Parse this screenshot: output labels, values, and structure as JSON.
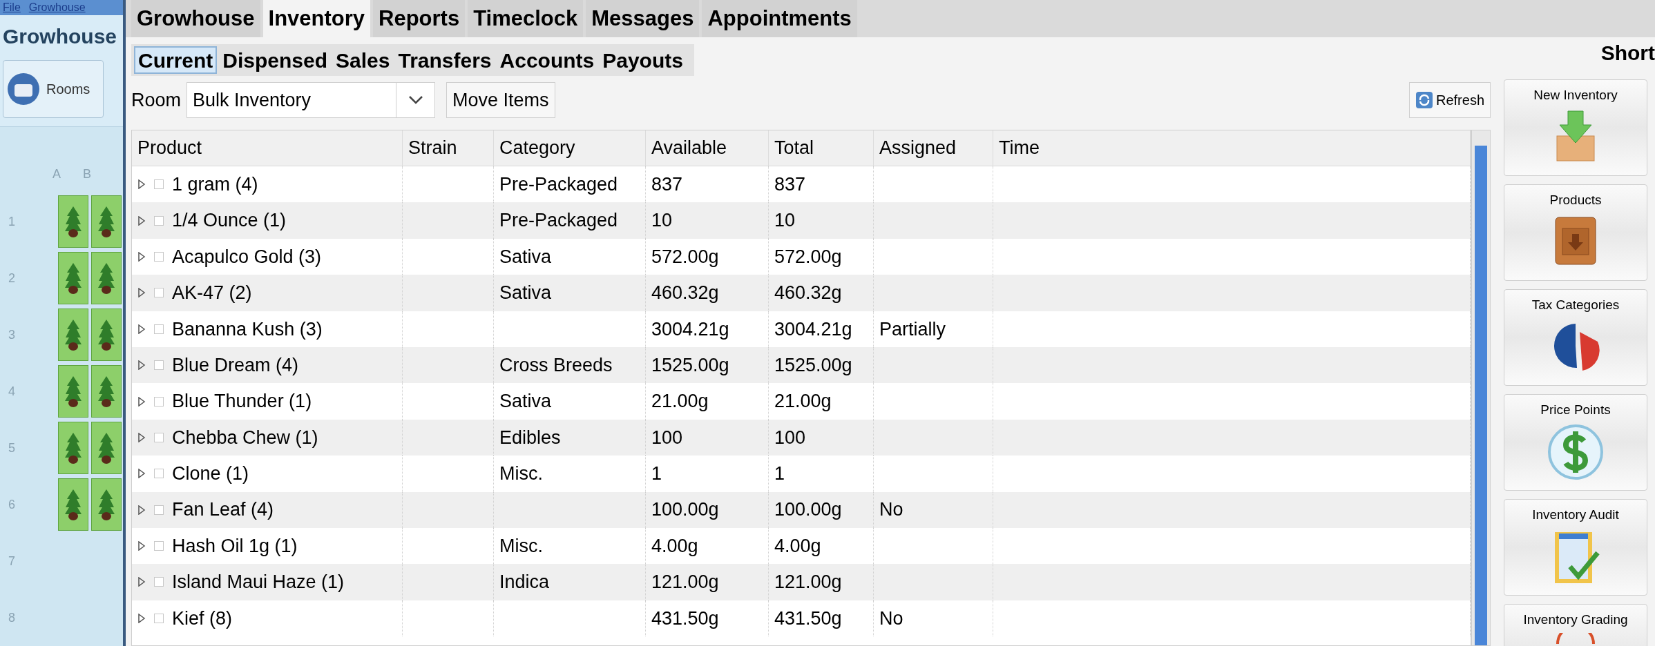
{
  "side_panel": {
    "menu": [
      "File",
      "Growhouse"
    ],
    "title": "Growhouse",
    "rooms_button": "Rooms",
    "grid": {
      "columns": [
        "A",
        "B"
      ],
      "rows": [
        {
          "label": "1",
          "cells": [
            false,
            true,
            true
          ]
        },
        {
          "label": "2",
          "cells": [
            false,
            true,
            true
          ]
        },
        {
          "label": "3",
          "cells": [
            false,
            true,
            true
          ]
        },
        {
          "label": "4",
          "cells": [
            false,
            true,
            true
          ]
        },
        {
          "label": "5",
          "cells": [
            false,
            true,
            true
          ]
        },
        {
          "label": "6",
          "cells": [
            false,
            true,
            true
          ]
        },
        {
          "label": "7",
          "cells": [
            false,
            false,
            false
          ]
        },
        {
          "label": "8",
          "cells": [
            false,
            false,
            false
          ]
        }
      ]
    }
  },
  "tabs": [
    {
      "label": "Growhouse",
      "selected": false
    },
    {
      "label": "Inventory",
      "selected": true
    },
    {
      "label": "Reports",
      "selected": false
    },
    {
      "label": "Timeclock",
      "selected": false
    },
    {
      "label": "Messages",
      "selected": false
    },
    {
      "label": "Appointments",
      "selected": false
    }
  ],
  "subtabs": [
    {
      "label": "Current",
      "selected": true
    },
    {
      "label": "Dispensed",
      "selected": false
    },
    {
      "label": "Sales",
      "selected": false
    },
    {
      "label": "Transfers",
      "selected": false
    },
    {
      "label": "Accounts",
      "selected": false
    },
    {
      "label": "Payouts",
      "selected": false
    }
  ],
  "toolbar": {
    "room_label": "Room",
    "room_value": "Bulk Inventory",
    "move_button": "Move Items",
    "refresh_button": "Refresh"
  },
  "table": {
    "columns": [
      "Product",
      "Strain",
      "Category",
      "Available",
      "Total",
      "Assigned",
      "Time"
    ],
    "rows": [
      {
        "cells": [
          "1 gram (4)",
          "",
          "Pre-Packaged",
          "837",
          "837",
          "",
          ""
        ],
        "checked": false
      },
      {
        "cells": [
          "1/4 Ounce (1)",
          "",
          "Pre-Packaged",
          "10",
          "10",
          "",
          ""
        ],
        "checked": false
      },
      {
        "cells": [
          "Acapulco Gold (3)",
          "",
          "Sativa",
          "572.00g",
          "572.00g",
          "",
          ""
        ],
        "checked": false
      },
      {
        "cells": [
          "AK-47 (2)",
          "",
          "Sativa",
          "460.32g",
          "460.32g",
          "",
          ""
        ],
        "checked": false
      },
      {
        "cells": [
          "Bananna Kush (3)",
          "",
          "",
          "3004.21g",
          "3004.21g",
          "Partially",
          ""
        ],
        "checked": false
      },
      {
        "cells": [
          "Blue Dream  (4)",
          "",
          "Cross Breeds",
          "1525.00g",
          "1525.00g",
          "",
          ""
        ],
        "checked": false
      },
      {
        "cells": [
          "Blue Thunder  (1)",
          "",
          "Sativa",
          "21.00g",
          "21.00g",
          "",
          ""
        ],
        "checked": false
      },
      {
        "cells": [
          "Chebba Chew (1)",
          "",
          "Edibles",
          "100",
          "100",
          "",
          ""
        ],
        "checked": false
      },
      {
        "cells": [
          "Clone  (1)",
          "",
          "Misc.",
          "1",
          "1",
          "",
          ""
        ],
        "checked": false
      },
      {
        "cells": [
          "Fan Leaf (4)",
          "",
          "",
          "100.00g",
          "100.00g",
          "No",
          ""
        ],
        "checked": false
      },
      {
        "cells": [
          "Hash Oil 1g (1)",
          "",
          "Misc.",
          "4.00g",
          "4.00g",
          "",
          ""
        ],
        "checked": false
      },
      {
        "cells": [
          "Island Maui Haze (1)",
          "",
          "Indica",
          "121.00g",
          "121.00g",
          "",
          ""
        ],
        "checked": false
      },
      {
        "cells": [
          "Kief (8)",
          "",
          "",
          "431.50g",
          "431.50g",
          "No",
          ""
        ],
        "checked": false
      }
    ]
  },
  "shortcuts": {
    "title": "Short",
    "items": [
      {
        "label": "New Inventory",
        "kind": "download"
      },
      {
        "label": "Products",
        "kind": "box"
      },
      {
        "label": "Tax Categories",
        "kind": "pie"
      },
      {
        "label": "Price Points",
        "kind": "dollar"
      },
      {
        "label": "Inventory Audit",
        "kind": "checklist"
      },
      {
        "label": "Inventory Grading",
        "kind": "dial"
      }
    ]
  }
}
